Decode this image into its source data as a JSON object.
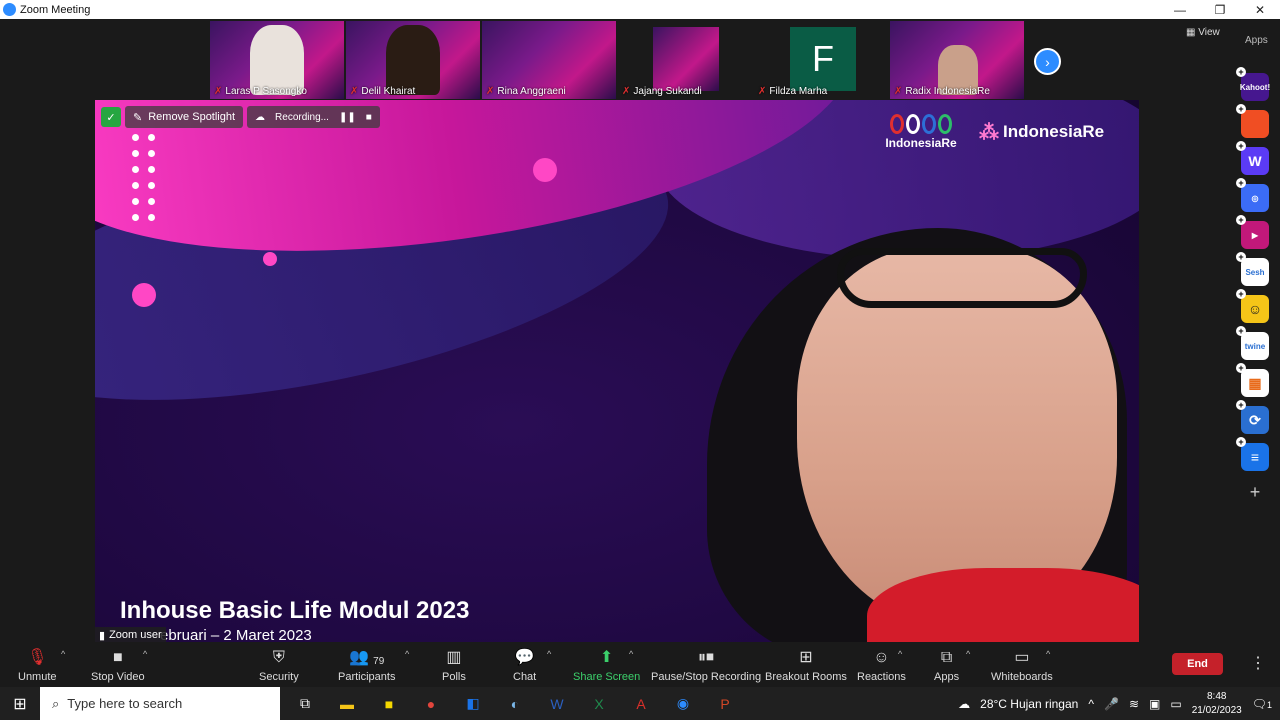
{
  "window": {
    "title": "Zoom Meeting",
    "controls": [
      "—",
      "❐",
      "✕"
    ]
  },
  "top_bar": {
    "view_label": "View",
    "apps_label": "Apps"
  },
  "participants_strip": [
    {
      "name": "Laras P Sasongko"
    },
    {
      "name": "Delil Khairat"
    },
    {
      "name": "Rina Anggraeni"
    },
    {
      "name": "Jajang Sukandi"
    },
    {
      "name": "Fildza Marha",
      "avatar_letter": "F"
    },
    {
      "name": "Radix IndonesiaRe"
    }
  ],
  "spotlight": {
    "remove_spotlight_label": "Remove Spotlight",
    "recording_label": "Recording...",
    "logo1_text": "IndonesiaRe",
    "logo2_text": "IndonesiaRe",
    "caption_title": "Inhouse Basic Life Modul 2023",
    "caption_sub": "ebruari – 2 Maret 2023",
    "zoom_user_label": "Zoom user"
  },
  "apps_sidebar": [
    {
      "name": "Kahoot!",
      "color": "#46178f",
      "label": "Kahoot!"
    },
    {
      "name": "app-orange",
      "color": "#f04e23",
      "label": ""
    },
    {
      "name": "Wooclap",
      "color": "#5b3bf5",
      "label": "W"
    },
    {
      "name": "app-blue-ring",
      "color": "#3b6cf6",
      "label": ""
    },
    {
      "name": "app-pink-video",
      "color": "#c2187a",
      "label": ""
    },
    {
      "name": "Sesh",
      "color": "#ffffff",
      "label": "Sesh"
    },
    {
      "name": "app-smiley",
      "color": "#f5c518",
      "label": ""
    },
    {
      "name": "twine",
      "color": "#ffffff",
      "label": "twine"
    },
    {
      "name": "app-grid",
      "color": "#ffffff",
      "label": ""
    },
    {
      "name": "app-sync",
      "color": "#2a6fd1",
      "label": ""
    },
    {
      "name": "app-stack",
      "color": "#1a73e8",
      "label": ""
    }
  ],
  "toolbar": {
    "unmute": "Unmute",
    "stop_video": "Stop Video",
    "security": "Security",
    "participants": "Participants",
    "participants_count": "79",
    "polls": "Polls",
    "chat": "Chat",
    "share_screen": "Share Screen",
    "pause_stop_recording": "Pause/Stop Recording",
    "breakout_rooms": "Breakout Rooms",
    "reactions": "Reactions",
    "apps": "Apps",
    "whiteboards": "Whiteboards",
    "end": "End"
  },
  "taskbar": {
    "search_placeholder": "Type here to search",
    "weather": "28°C  Hujan ringan",
    "time": "8:48",
    "date": "21/02/2023",
    "notification_count": "1"
  }
}
